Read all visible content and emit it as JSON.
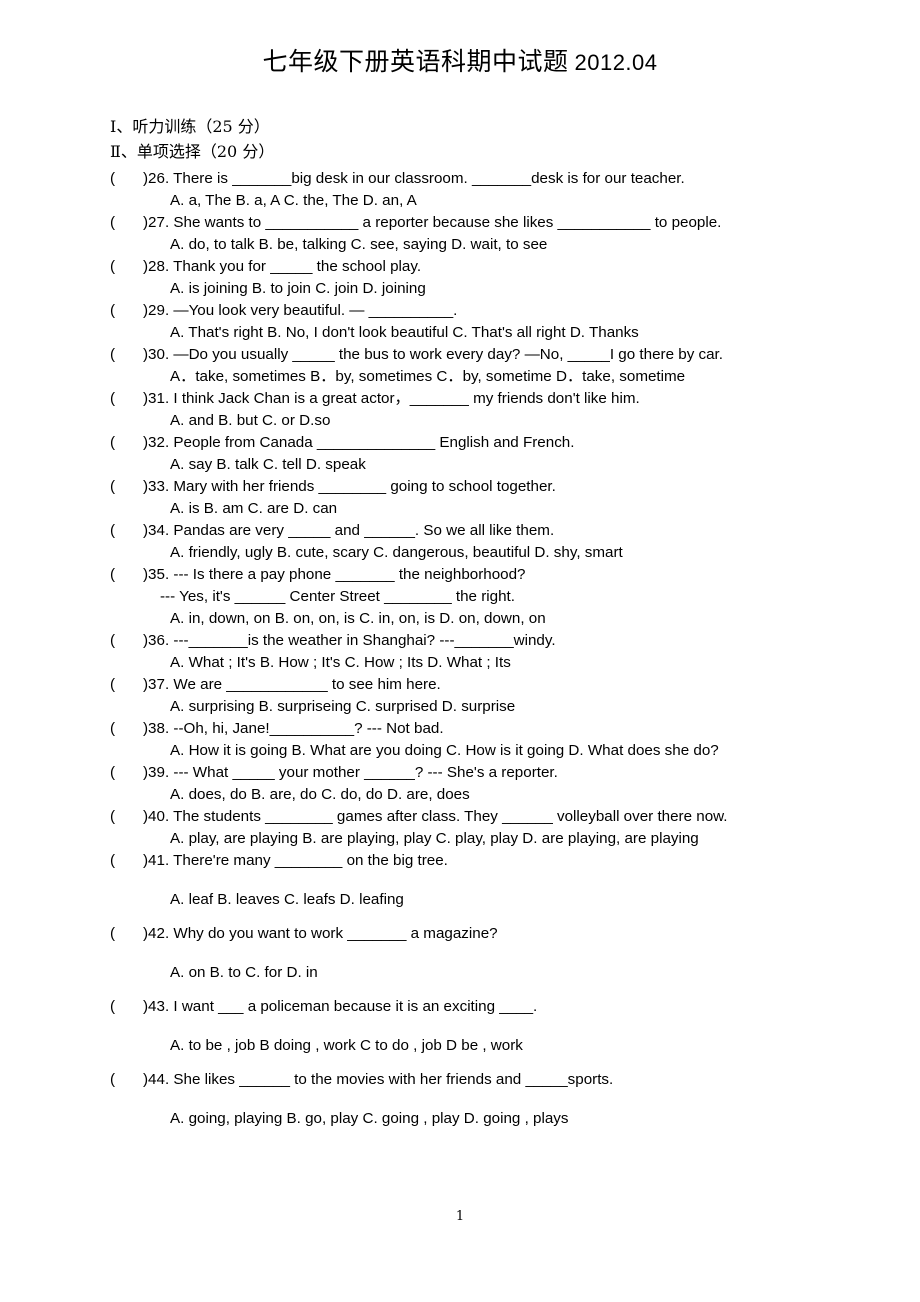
{
  "document": {
    "title_cn": "七年级下册英语科期中试题",
    "title_date": "2012.04",
    "page_number": "1"
  },
  "sections": [
    {
      "label": "Ⅰ、听力训练（25 分）"
    },
    {
      "label": "Ⅱ、单项选择（20 分）"
    }
  ],
  "questions": [
    {
      "paren": "(",
      "stem": ")26. There is _______big desk in our classroom. _______desk is for our teacher.",
      "options": "A. a, The                    B. a, A                      C. the, The           D. an, A",
      "spacing": "tight"
    },
    {
      "paren": "(",
      "stem": ")27. She wants to ___________ a reporter because she likes ___________ to people.",
      "options": "A. do, to talk            B. be, talking            C. see, saying        D. wait, to see",
      "spacing": "tight"
    },
    {
      "paren": "(",
      "stem": ")28. Thank you for _____ the school play.",
      "options": "A. is joining                B. to join                   C. join                  D. joining",
      "spacing": "tight"
    },
    {
      "paren": "(",
      "stem": ")29. —You look very beautiful. — __________.",
      "options": "A. That's right      B. No, I don't look beautiful     C. That's all right      D. Thanks",
      "spacing": "tight"
    },
    {
      "paren": "(",
      "stem": ")30. —Do you usually _____ the bus to work every day?    —No, _____I go there by car.",
      "options": "A．take, sometimes     B．by, sometimes     C．by, sometime      D．take, sometime",
      "spacing": "tight"
    },
    {
      "paren": "(",
      "stem": ")31. I think Jack Chan is a great actor，_______ my friends don't like him.",
      "options": "A. and                         B. but                     C. or                       D.so",
      "spacing": "tight"
    },
    {
      "paren": "(",
      "stem": ")32. People from Canada ______________ English and French.",
      "options": "A. say              B. talk                         C. tell                      D. speak",
      "spacing": "tight"
    },
    {
      "paren": "(",
      "stem": ")33. Mary with her friends ________ going to school together.",
      "options": "A. is      B. am     C. are     D. can",
      "spacing": "tight"
    },
    {
      "paren": "(",
      "stem": ")34. Pandas are very _____ and ______. So we all like them.",
      "options": "A. friendly, ugly         B. cute, scary        C. dangerous, beautiful      D. shy, smart",
      "spacing": "tight"
    },
    {
      "paren": "(",
      "stem": ")35. --- Is there a pay phone _______ the neighborhood?",
      "subline": "--- Yes, it's ______ Center Street ________ the right.",
      "options": "A. in, down, on          B. on, on, is             C. in, on, is                D. on, down, on",
      "spacing": "tight"
    },
    {
      "paren": "(",
      "stem": ")36. ---_______is the weather in Shanghai?    ---_______windy.",
      "options": "A. What ; It's        B. How ; It's                 C. How ; Its          D. What ; Its",
      "spacing": "tight"
    },
    {
      "paren": "(",
      "stem": ")37. We are ____________ to see him here.",
      "options": "A. surprising       B. surpriseing        C. surprised       D. surprise",
      "spacing": "tight"
    },
    {
      "paren": "(",
      "stem": ")38. --Oh, hi, Jane!__________? --- Not bad.",
      "options": "A. How it is going       B. What are you doing     C. How is it going      D. What does she do?",
      "spacing": "tight"
    },
    {
      "paren": "(",
      "stem": ")39. --- What _____ your mother ______? --- She's a reporter.",
      "options": "A. does, do                  B. are, do                C. do, do             D. are, does",
      "spacing": "tight"
    },
    {
      "paren": "(",
      "stem": ")40. The students ________ games after class. They ______ volleyball over there now.",
      "options": "A. play, are playing   B. are playing, play   C. play, play   D. are playing, are playing",
      "spacing": "tight"
    },
    {
      "paren": "(",
      "stem": ")41. There're many ________ on the big tree.",
      "options": "A. leaf              B. leaves                C. leafs            D. leafing",
      "spacing": "loose"
    },
    {
      "paren": "(",
      "stem": ")42. Why do you want to work _______ a magazine?",
      "options": "A. on                  B. to                     C. for             D. in",
      "spacing": "loose"
    },
    {
      "paren": "(",
      "stem": ")43. I want ___ a   policeman   because   it   is   an exciting ____.",
      "options": "A. to be , job        B doing , work      C to do , job       D be , work",
      "spacing": "loose"
    },
    {
      "paren": "(",
      "stem": ")44. She likes ______ to the movies with her friends and _____sports.",
      "options": "A. going, playing    B. go, play     C. going , play      D. going , plays",
      "spacing": "loose"
    }
  ]
}
